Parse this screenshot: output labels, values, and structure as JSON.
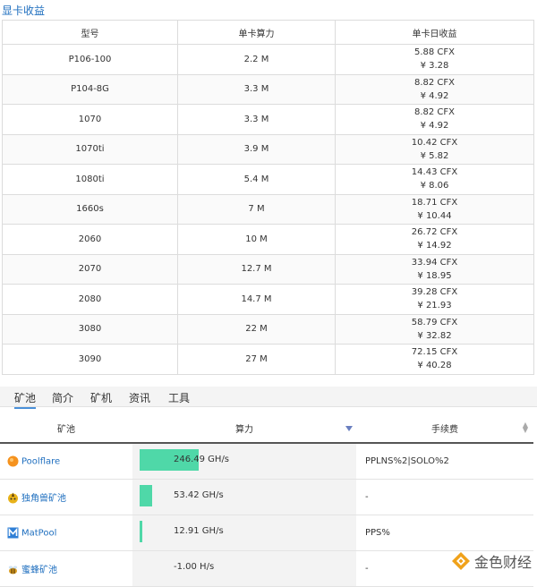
{
  "gpu_section": {
    "title": "显卡收益",
    "headers": [
      "型号",
      "单卡算力",
      "单卡日收益"
    ],
    "rows": [
      {
        "model": "P106-100",
        "hashrate": "2.2 M",
        "cfx": "5.88 CFX",
        "cny": "¥ 3.28"
      },
      {
        "model": "P104-8G",
        "hashrate": "3.3 M",
        "cfx": "8.82 CFX",
        "cny": "¥ 4.92"
      },
      {
        "model": "1070",
        "hashrate": "3.3 M",
        "cfx": "8.82 CFX",
        "cny": "¥ 4.92"
      },
      {
        "model": "1070ti",
        "hashrate": "3.9 M",
        "cfx": "10.42 CFX",
        "cny": "¥ 5.82"
      },
      {
        "model": "1080ti",
        "hashrate": "5.4 M",
        "cfx": "14.43 CFX",
        "cny": "¥ 8.06"
      },
      {
        "model": "1660s",
        "hashrate": "7 M",
        "cfx": "18.71 CFX",
        "cny": "¥ 10.44"
      },
      {
        "model": "2060",
        "hashrate": "10 M",
        "cfx": "26.72 CFX",
        "cny": "¥ 14.92"
      },
      {
        "model": "2070",
        "hashrate": "12.7 M",
        "cfx": "33.94 CFX",
        "cny": "¥ 18.95"
      },
      {
        "model": "2080",
        "hashrate": "14.7 M",
        "cfx": "39.28 CFX",
        "cny": "¥ 21.93"
      },
      {
        "model": "3080",
        "hashrate": "22 M",
        "cfx": "58.79 CFX",
        "cny": "¥ 32.82"
      },
      {
        "model": "3090",
        "hashrate": "27 M",
        "cfx": "72.15 CFX",
        "cny": "¥ 40.28"
      }
    ]
  },
  "tabs": [
    {
      "label": "矿池",
      "active": true
    },
    {
      "label": "简介",
      "active": false
    },
    {
      "label": "矿机",
      "active": false
    },
    {
      "label": "资讯",
      "active": false
    },
    {
      "label": "工具",
      "active": false
    }
  ],
  "pool_section": {
    "headers": [
      "矿池",
      "算力",
      "手续费"
    ],
    "rows": [
      {
        "name": "Poolflare",
        "icon": "orange-circle-icon",
        "hashrate": "246.49 GH/s",
        "share": 1.0,
        "fee": "PPLNS%2|SOLO%2"
      },
      {
        "name": "独角兽矿池",
        "icon": "unicorn-icon",
        "hashrate": "53.42 GH/s",
        "share": 0.2167,
        "fee": "-"
      },
      {
        "name": "MatPool",
        "icon": "matpool-m-icon",
        "hashrate": "12.91 GH/s",
        "share": 0.0524,
        "fee": "PPS%"
      },
      {
        "name": "蜜蜂矿池",
        "icon": "bee-icon",
        "hashrate": "-1.00 H/s",
        "share": 0,
        "fee": "-"
      }
    ]
  },
  "colors": {
    "accent": "#1f6fbf",
    "bar": "#4fd8a8",
    "tab_underline": "#4a90d9"
  },
  "logo": {
    "text": "金色财经",
    "icon": "jinse-logo-icon"
  }
}
